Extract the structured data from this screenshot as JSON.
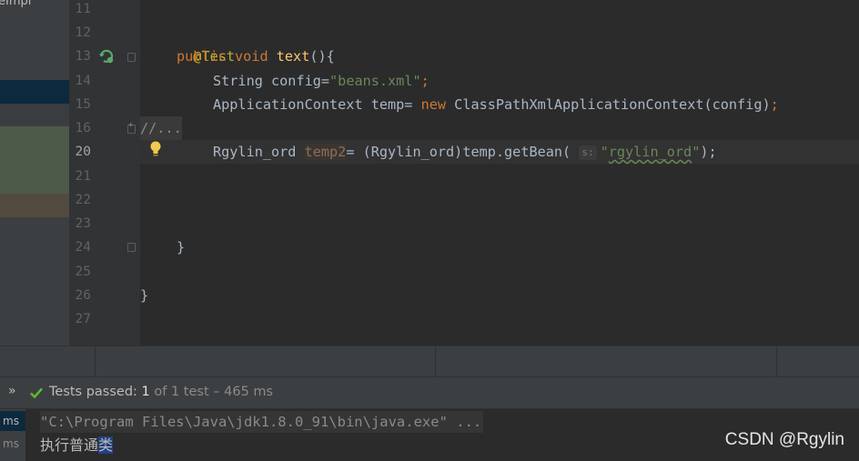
{
  "project_panel": {
    "title_fragment": "eImpl"
  },
  "gutter": {
    "lines": [
      "11",
      "12",
      "13",
      "14",
      "15",
      "16",
      "20",
      "21",
      "22",
      "23",
      "24",
      "25",
      "26",
      "27"
    ],
    "active_line": "20"
  },
  "editor": {
    "annotation": "@Test",
    "method": {
      "kw_public": "public",
      "kw_void": "void",
      "name": "text",
      "tail": "(){"
    },
    "line14": {
      "type": "String",
      "rest": " config=",
      "string": "\"beans.xml\"",
      "semi": ";"
    },
    "line15": {
      "pre": "ApplicationContext temp= ",
      "kw_new": "new",
      "rest": " ClassPathXmlApplicationContext(config)",
      "semi": ";"
    },
    "line16": {
      "folded": "//..."
    },
    "line20": {
      "pre": "Rgylin_ord ",
      "var": "temp2",
      "mid": "= (Rgylin_ord)temp.getBean( ",
      "hint": "s:",
      "string_q1": "\"",
      "string_body": "rgylin_ord",
      "string_q2": "\"",
      "tail": ");"
    },
    "close_method": "}",
    "close_class": "}"
  },
  "run": {
    "expand_glyph": "»",
    "status_prefix": "Tests passed: ",
    "passed_count": "1",
    "status_suffix": " of 1 test – 465 ms",
    "side_labels": [
      "ms",
      "ms"
    ],
    "output_line1": "\"C:\\Program Files\\Java\\jdk1.8.0_91\\bin\\java.exe\" ...",
    "output_line2_main": "执行普通",
    "output_line2_selected": "类"
  },
  "watermark": "CSDN @Rgylin",
  "colors": {
    "editor_bg": "#2b2b2b",
    "keyword": "#cc7832",
    "string": "#6a8759",
    "annotation": "#bbb529",
    "method": "#ffc66d",
    "pass_green": "#5fb832"
  }
}
